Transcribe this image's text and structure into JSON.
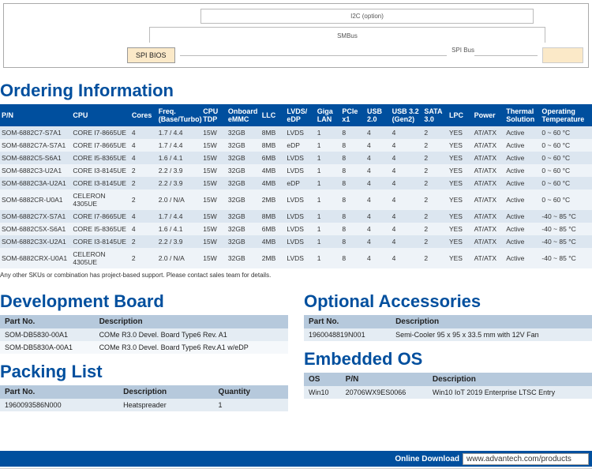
{
  "block_diagram": {
    "spi_bios": "SPI BIOS",
    "bus_i2c": "I2C (option)",
    "bus_smbus": "SMBus",
    "bus_spi": "SPI Bus"
  },
  "titles": {
    "ordering": "Ordering Information",
    "dev_board": "Development Board",
    "packing": "Packing List",
    "accessories": "Optional Accessories",
    "os": "Embedded OS"
  },
  "ordering": {
    "headers": [
      "P/N",
      "CPU",
      "Cores",
      "Freq. (Base/Turbo)",
      "CPU TDP",
      "Onboard eMMC",
      "LLC",
      "LVDS/ eDP",
      "Giga LAN",
      "PCIe x1",
      "USB 2.0",
      "USB 3.2 (Gen2)",
      "SATA 3.0",
      "LPC",
      "Power",
      "Thermal Solution",
      "Operating Temperature"
    ],
    "rows": [
      [
        "SOM-6882C7-S7A1",
        "CORE I7-8665UE",
        "4",
        "1.7 / 4.4",
        "15W",
        "32GB",
        "8MB",
        "LVDS",
        "1",
        "8",
        "4",
        "4",
        "2",
        "YES",
        "AT/ATX",
        "Active",
        "0 ~ 60 °C"
      ],
      [
        "SOM-6882C7A-S7A1",
        "CORE I7-8665UE",
        "4",
        "1.7 / 4.4",
        "15W",
        "32GB",
        "8MB",
        "eDP",
        "1",
        "8",
        "4",
        "4",
        "2",
        "YES",
        "AT/ATX",
        "Active",
        "0 ~ 60 °C"
      ],
      [
        "SOM-6882C5-S6A1",
        "CORE I5-8365UE",
        "4",
        "1.6 / 4.1",
        "15W",
        "32GB",
        "6MB",
        "LVDS",
        "1",
        "8",
        "4",
        "4",
        "2",
        "YES",
        "AT/ATX",
        "Active",
        "0 ~ 60 °C"
      ],
      [
        "SOM-6882C3-U2A1",
        "CORE I3-8145UE",
        "2",
        "2.2 / 3.9",
        "15W",
        "32GB",
        "4MB",
        "LVDS",
        "1",
        "8",
        "4",
        "4",
        "2",
        "YES",
        "AT/ATX",
        "Active",
        "0 ~ 60 °C"
      ],
      [
        "SOM-6882C3A-U2A1",
        "CORE I3-8145UE",
        "2",
        "2.2 / 3.9",
        "15W",
        "32GB",
        "4MB",
        "eDP",
        "1",
        "8",
        "4",
        "4",
        "2",
        "YES",
        "AT/ATX",
        "Active",
        "0 ~ 60 °C"
      ],
      [
        "SOM-6882CR-U0A1",
        "CELERON 4305UE",
        "2",
        "2.0 / N/A",
        "15W",
        "32GB",
        "2MB",
        "LVDS",
        "1",
        "8",
        "4",
        "4",
        "2",
        "YES",
        "AT/ATX",
        "Active",
        "0 ~ 60 °C"
      ],
      [
        "SOM-6882C7X-S7A1",
        "CORE I7-8665UE",
        "4",
        "1.7 / 4.4",
        "15W",
        "32GB",
        "8MB",
        "LVDS",
        "1",
        "8",
        "4",
        "4",
        "2",
        "YES",
        "AT/ATX",
        "Active",
        "-40 ~ 85 °C"
      ],
      [
        "SOM-6882C5X-S6A1",
        "CORE I5-8365UE",
        "4",
        "1.6 / 4.1",
        "15W",
        "32GB",
        "6MB",
        "LVDS",
        "1",
        "8",
        "4",
        "4",
        "2",
        "YES",
        "AT/ATX",
        "Active",
        "-40 ~ 85 °C"
      ],
      [
        "SOM-6882C3X-U2A1",
        "CORE I3-8145UE",
        "2",
        "2.2 / 3.9",
        "15W",
        "32GB",
        "4MB",
        "LVDS",
        "1",
        "8",
        "4",
        "4",
        "2",
        "YES",
        "AT/ATX",
        "Active",
        "-40 ~ 85 °C"
      ],
      [
        "SOM-6882CRX-U0A1",
        "CELERON 4305UE",
        "2",
        "2.0 / N/A",
        "15W",
        "32GB",
        "2MB",
        "LVDS",
        "1",
        "8",
        "4",
        "4",
        "2",
        "YES",
        "AT/ATX",
        "Active",
        "-40 ~ 85 °C"
      ]
    ],
    "note": "Any other SKUs or combination has project-based support. Please contact sales team for details."
  },
  "dev_board": {
    "headers": [
      "Part No.",
      "Description"
    ],
    "rows": [
      [
        "SOM-DB5830-00A1",
        "COMe R3.0 Devel. Board Type6 Rev. A1"
      ],
      [
        "SOM-DB5830A-00A1",
        "COMe R3.0 Devel. Board Type6 Rev.A1 w/eDP"
      ]
    ]
  },
  "packing": {
    "headers": [
      "Part No.",
      "Description",
      "Quantity"
    ],
    "rows": [
      [
        "1960093586N000",
        "Heatspreader",
        "1"
      ]
    ]
  },
  "accessories": {
    "headers": [
      "Part No.",
      "Description"
    ],
    "rows": [
      [
        "1960048819N001",
        "Semi-Cooler 95 x 95 x 33.5 mm with 12V Fan"
      ]
    ]
  },
  "os": {
    "headers": [
      "OS",
      "P/N",
      "Description"
    ],
    "rows": [
      [
        "Win10",
        "20706WX9ES0066",
        "Win10 IoT 2019 Enterprise LTSC Entry"
      ]
    ]
  },
  "footer": {
    "label": "Online Download",
    "url": "www.advantech.com/products"
  }
}
